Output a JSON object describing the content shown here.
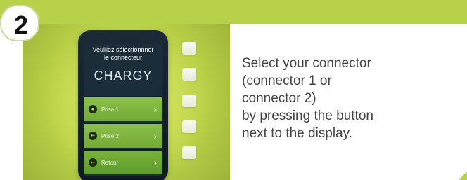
{
  "step": {
    "number": "2"
  },
  "device": {
    "title_lines": [
      "Veuillez sélectionnner",
      "le connecteur"
    ],
    "brand": "CHARGY",
    "menu": [
      {
        "label": "Prise 1",
        "icon": "single-dot-icon"
      },
      {
        "label": "Prise 2",
        "icon": "double-dot-icon"
      },
      {
        "label": "Retour",
        "icon": "back-arrow-icon"
      }
    ]
  },
  "instructions": {
    "lines": [
      "Select your connector",
      "(connector 1 or",
      "connector 2)",
      "by pressing the button",
      "next to the display."
    ]
  },
  "colors": {
    "accent_green": "#b7d14a",
    "screen_bg": "#1a2d39",
    "menu_green": "#7fb43e"
  }
}
